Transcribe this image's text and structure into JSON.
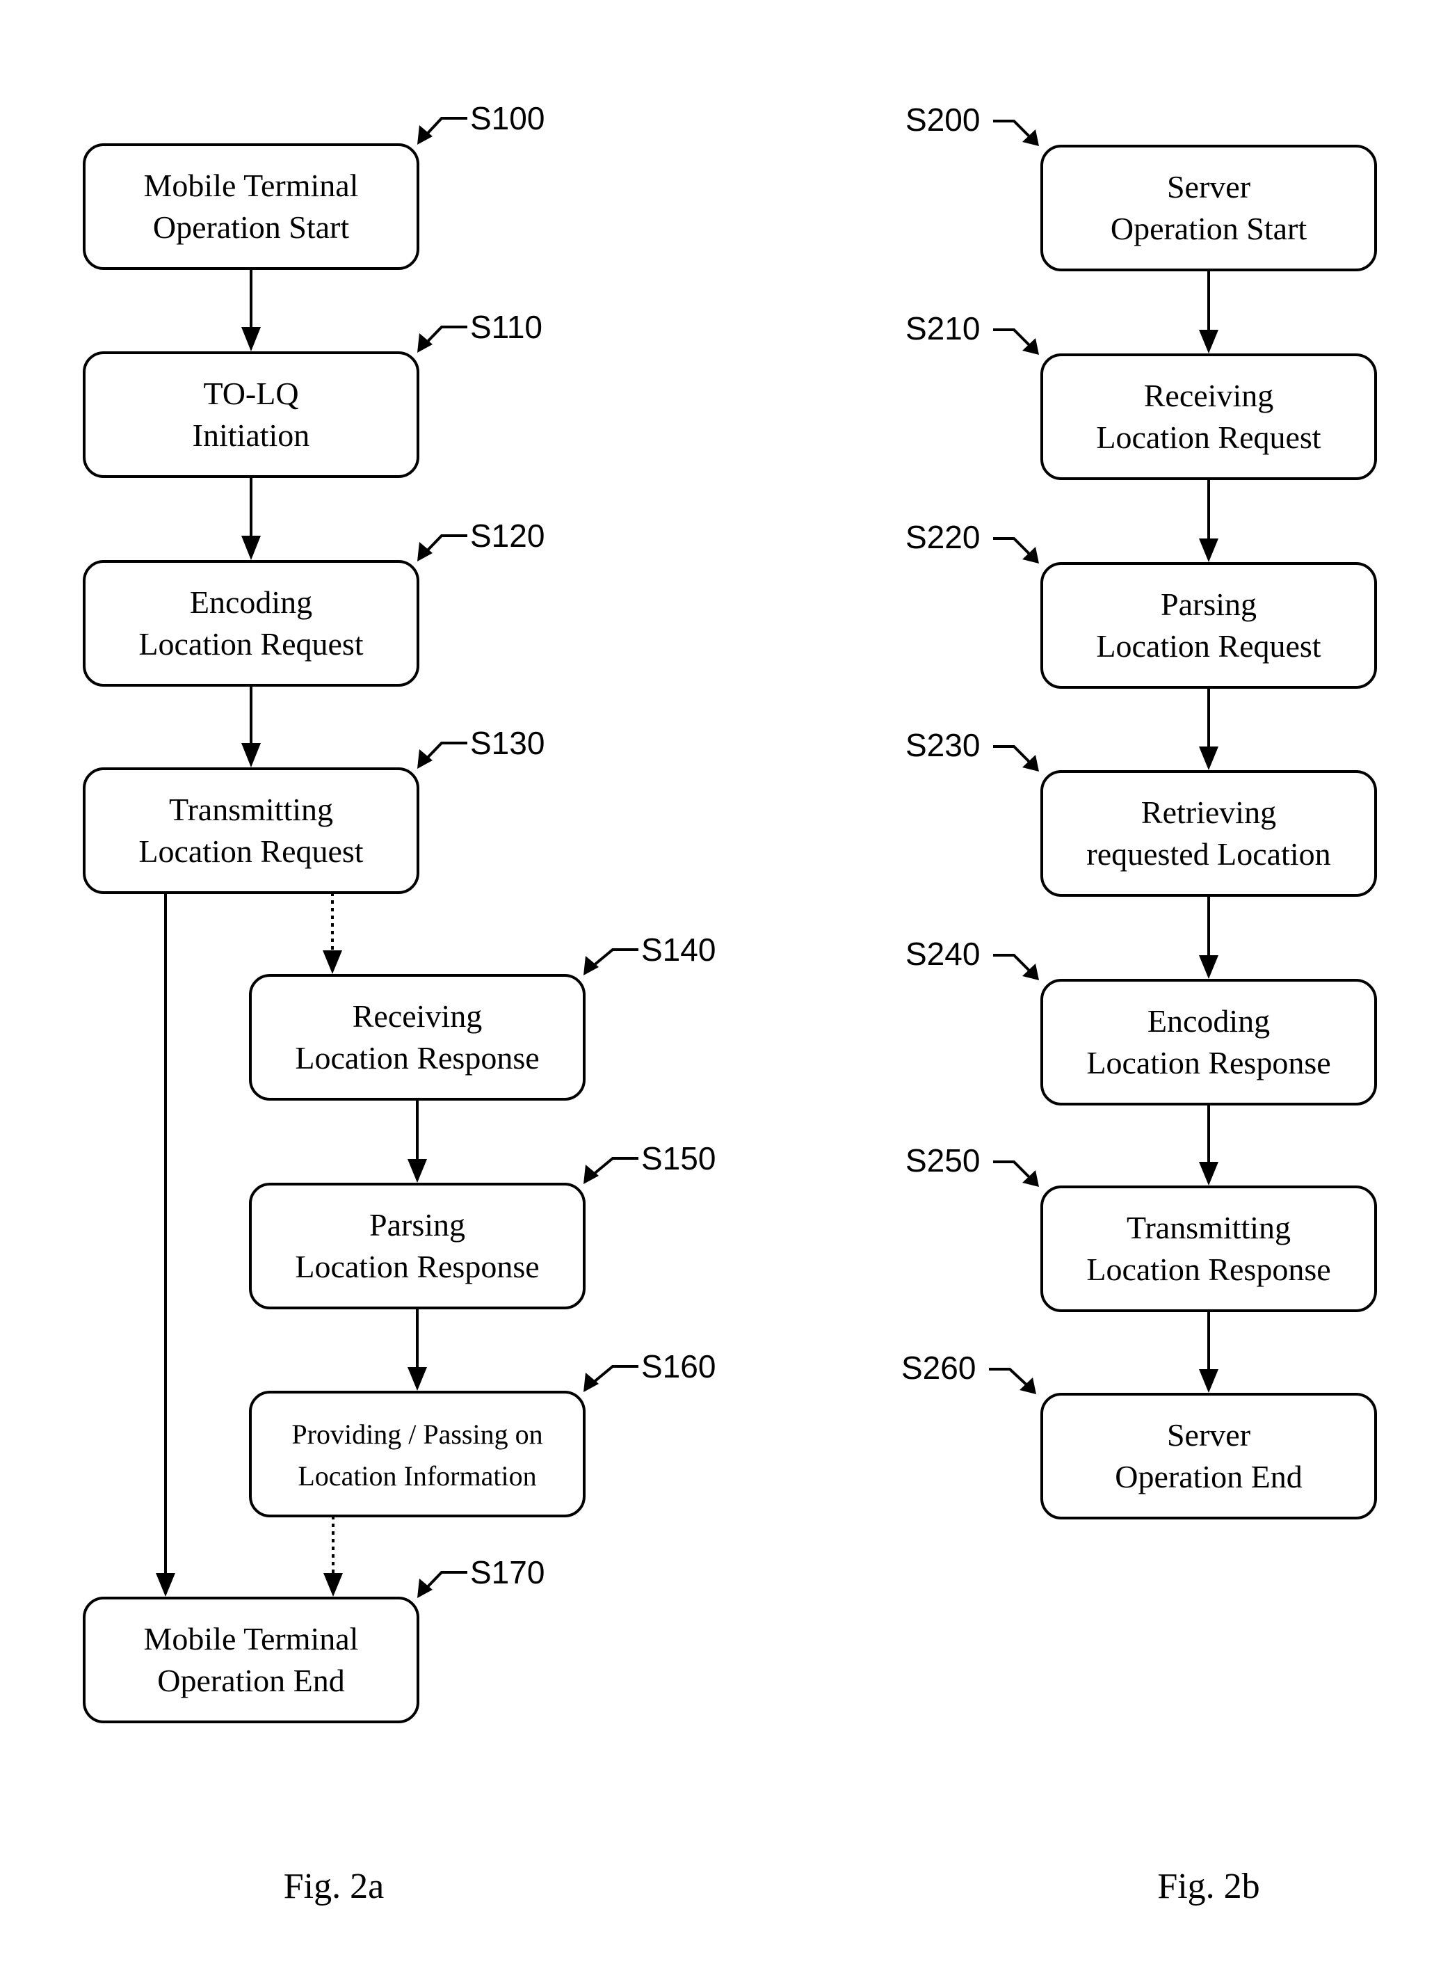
{
  "figures": [
    {
      "id": "fig2a",
      "caption": "Fig. 2a",
      "steps": [
        {
          "label": "S100",
          "lines": [
            "Mobile Terminal",
            "Operation Start"
          ]
        },
        {
          "label": "S110",
          "lines": [
            "TO-LQ",
            "Initiation"
          ]
        },
        {
          "label": "S120",
          "lines": [
            "Encoding",
            "Location Request"
          ]
        },
        {
          "label": "S130",
          "lines": [
            "Transmitting",
            "Location Request"
          ]
        },
        {
          "label": "S140",
          "lines": [
            "Receiving",
            "Location Response"
          ]
        },
        {
          "label": "S150",
          "lines": [
            "Parsing",
            "Location Response"
          ]
        },
        {
          "label": "S160",
          "lines": [
            "Providing / Passing on",
            "Location Information"
          ]
        },
        {
          "label": "S170",
          "lines": [
            "Mobile Terminal",
            "Operation End"
          ]
        }
      ],
      "connections": [
        {
          "from": "S100",
          "to": "S110",
          "style": "solid"
        },
        {
          "from": "S110",
          "to": "S120",
          "style": "solid"
        },
        {
          "from": "S120",
          "to": "S130",
          "style": "solid"
        },
        {
          "from": "S130",
          "to": "S140",
          "style": "dotted"
        },
        {
          "from": "S140",
          "to": "S150",
          "style": "solid"
        },
        {
          "from": "S150",
          "to": "S160",
          "style": "solid"
        },
        {
          "from": "S160",
          "to": "S170",
          "style": "dotted"
        },
        {
          "from": "S130",
          "to": "S170",
          "style": "solid"
        }
      ]
    },
    {
      "id": "fig2b",
      "caption": "Fig. 2b",
      "steps": [
        {
          "label": "S200",
          "lines": [
            "Server",
            "Operation Start"
          ]
        },
        {
          "label": "S210",
          "lines": [
            "Receiving",
            "Location Request"
          ]
        },
        {
          "label": "S220",
          "lines": [
            "Parsing",
            "Location Request"
          ]
        },
        {
          "label": "S230",
          "lines": [
            "Retrieving",
            "requested Location"
          ]
        },
        {
          "label": "S240",
          "lines": [
            "Encoding",
            "Location Response"
          ]
        },
        {
          "label": "S250",
          "lines": [
            "Transmitting",
            "Location Response"
          ]
        },
        {
          "label": "S260",
          "lines": [
            "Server",
            "Operation End"
          ]
        }
      ],
      "connections": [
        {
          "from": "S200",
          "to": "S210",
          "style": "solid"
        },
        {
          "from": "S210",
          "to": "S220",
          "style": "solid"
        },
        {
          "from": "S220",
          "to": "S230",
          "style": "solid"
        },
        {
          "from": "S230",
          "to": "S240",
          "style": "solid"
        },
        {
          "from": "S240",
          "to": "S250",
          "style": "solid"
        },
        {
          "from": "S250",
          "to": "S260",
          "style": "solid"
        }
      ]
    }
  ]
}
